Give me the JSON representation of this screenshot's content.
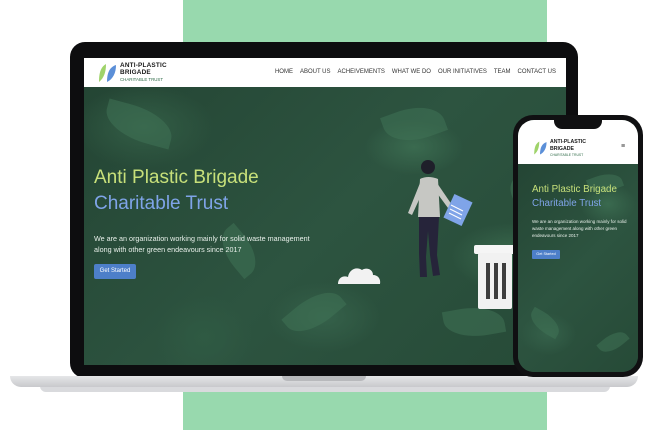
{
  "site": {
    "brand_line1": "ANTI-PLASTIC",
    "brand_line2": "BRIGADE",
    "brand_line3": "CHARITABLE TRUST"
  },
  "nav": {
    "items": [
      {
        "label": "HOME"
      },
      {
        "label": "ABOUT US"
      },
      {
        "label": "ACHEIVEMENTS"
      },
      {
        "label": "WHAT WE DO"
      },
      {
        "label": "OUR INITIATIVES"
      },
      {
        "label": "TEAM"
      },
      {
        "label": "CONTACT US"
      }
    ],
    "mobile_menu_icon": "≡"
  },
  "hero": {
    "title_line1": "Anti Plastic Brigade",
    "title_line2": "Charitable Trust",
    "description": "We are an organization working mainly for solid waste management along with other green endeavours since 2017",
    "button_label": "Get Started"
  },
  "colors": {
    "mint_background": "#98d9ae",
    "hero_green": "#2a4c3a",
    "title_green": "#c7e07a",
    "title_blue": "#7fa4e8",
    "button_blue": "#4d7fc9"
  },
  "icons": {
    "logo": "leaf-logo-icon",
    "menu": "hamburger-menu-icon"
  }
}
